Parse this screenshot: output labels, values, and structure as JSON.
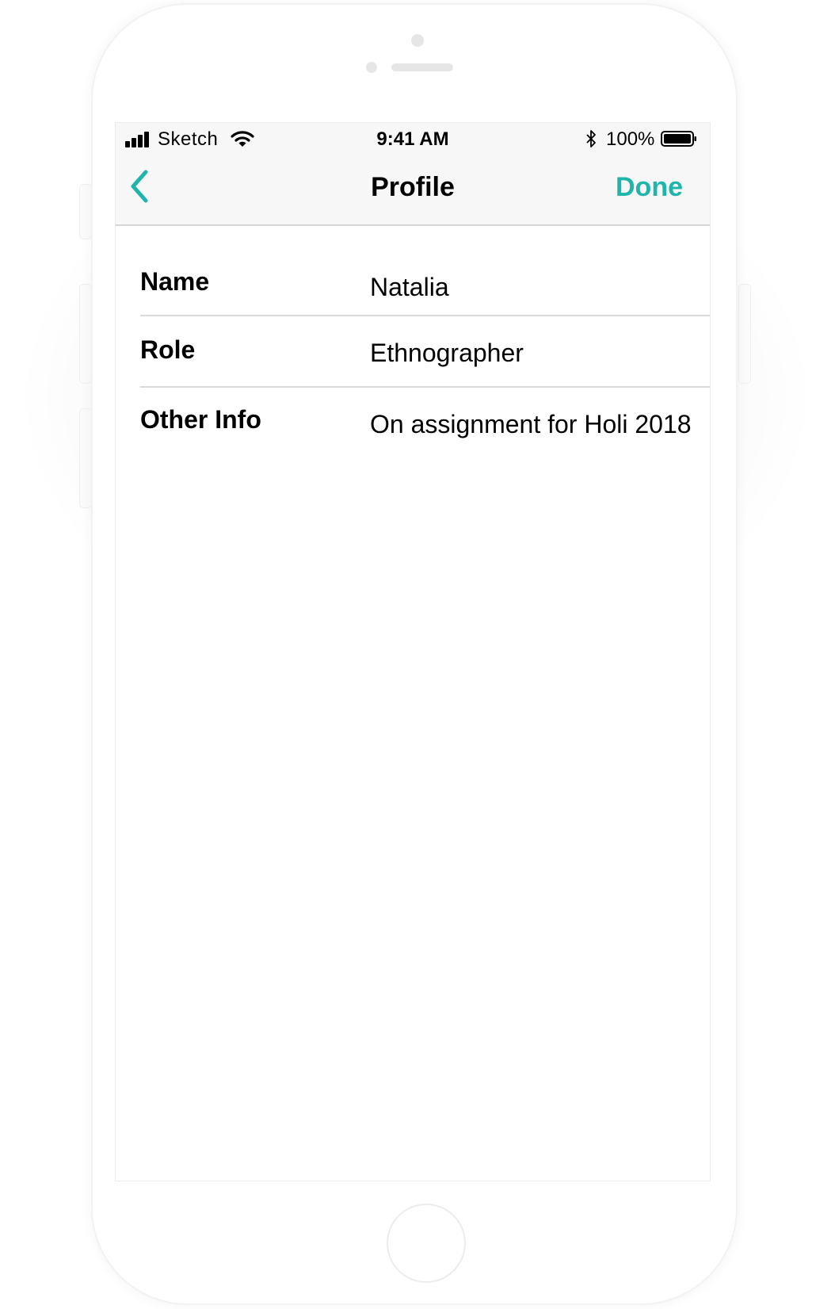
{
  "status_bar": {
    "carrier": "Sketch",
    "time": "9:41 AM",
    "battery_percent": "100%",
    "signal_icon": "cellular-signal-icon",
    "wifi_icon": "wifi-icon",
    "bluetooth_icon": "bluetooth-icon",
    "battery_icon": "battery-icon"
  },
  "nav": {
    "title": "Profile",
    "back_icon": "chevron-left-icon",
    "done_label": "Done"
  },
  "profile": {
    "rows": [
      {
        "label": "Name",
        "value": "Natalia"
      },
      {
        "label": "Role",
        "value": "Ethnographer"
      },
      {
        "label": "Other Info",
        "value": "On assignment for Holi 2018"
      }
    ]
  },
  "colors": {
    "accent": "#1fb5ab",
    "nav_background": "#f7f7f7",
    "separator": "#d9d9d9",
    "text": "#000000"
  }
}
